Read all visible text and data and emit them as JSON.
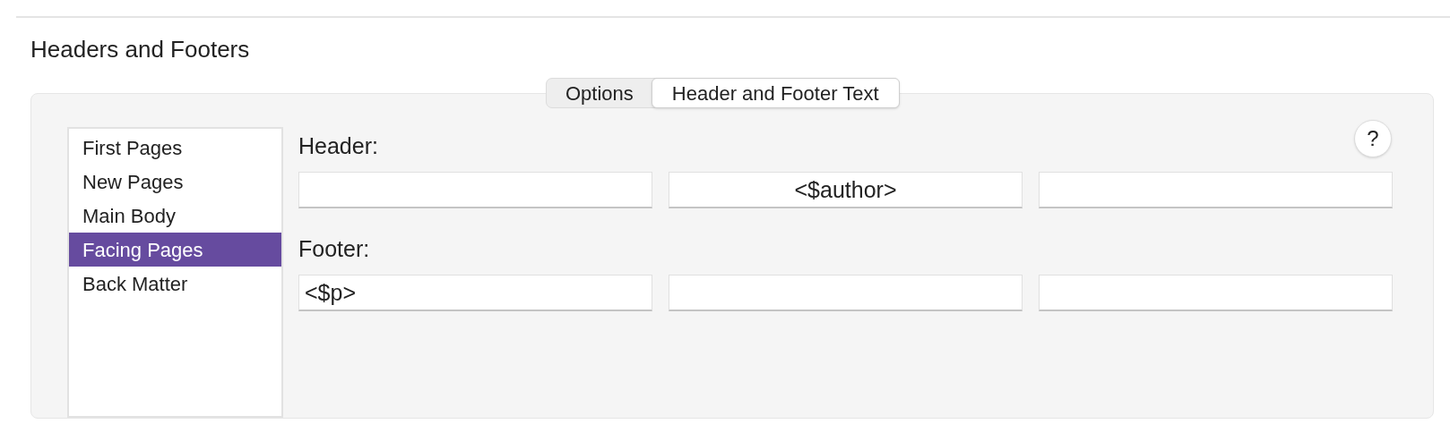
{
  "section_title": "Headers and Footers",
  "tabs": [
    {
      "label": "Options",
      "selected": false
    },
    {
      "label": "Header and Footer Text",
      "selected": true
    }
  ],
  "sidebar": {
    "items": [
      {
        "label": "First Pages",
        "selected": false
      },
      {
        "label": "New Pages",
        "selected": false
      },
      {
        "label": "Main Body",
        "selected": false
      },
      {
        "label": "Facing Pages",
        "selected": true
      },
      {
        "label": "Back Matter",
        "selected": false
      }
    ]
  },
  "help_button": {
    "label": "?"
  },
  "header": {
    "label": "Header:",
    "fields": {
      "center": "<$author>"
    }
  },
  "footer": {
    "label": "Footer:",
    "fields": {
      "left": "<$p>"
    }
  }
}
